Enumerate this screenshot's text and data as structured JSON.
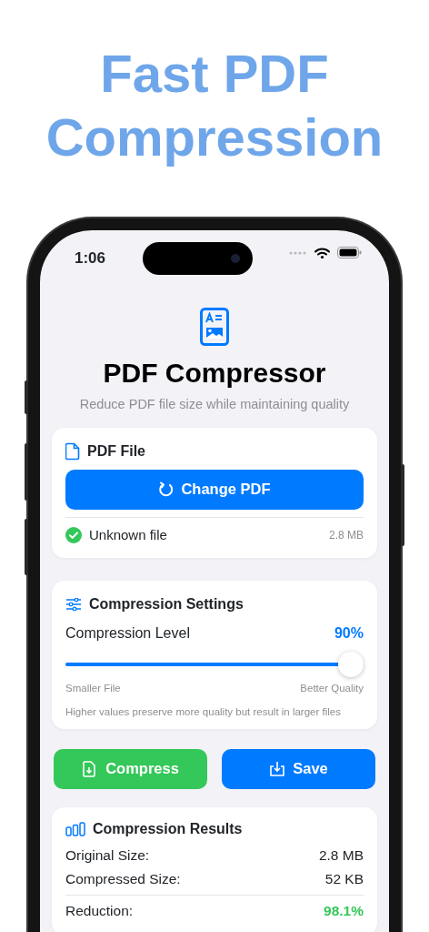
{
  "headline": "Fast PDF Compression",
  "status_bar": {
    "time": "1:06"
  },
  "app": {
    "title": "PDF Compressor",
    "subtitle": "Reduce PDF file size while maintaining quality"
  },
  "file_card": {
    "title": "PDF File",
    "button": "Change PDF",
    "file_name": "Unknown file",
    "file_size": "2.8 MB",
    "loaded": true
  },
  "settings_card": {
    "title": "Compression Settings",
    "label": "Compression Level",
    "reading": "90%",
    "slider": {
      "level": 1
    },
    "min_label": "Smaller File",
    "max_label": "Better Quality",
    "hint": "Higher values preserve more quality but result in larger files"
  },
  "actions": [
    {
      "label": "Compress",
      "kind": "compress",
      "color": "#34c759"
    },
    {
      "label": "Save",
      "kind": "save",
      "color": "#007aff"
    }
  ],
  "results_card": {
    "title": "Compression Results",
    "rows": [
      {
        "label": "Original Size:",
        "value": "2.8 MB",
        "kind": "size"
      },
      {
        "label": "Compressed Size:",
        "value": "52 KB",
        "kind": "size"
      },
      {
        "label": "Reduction:",
        "value": "98.1%",
        "kind": "total"
      }
    ]
  }
}
